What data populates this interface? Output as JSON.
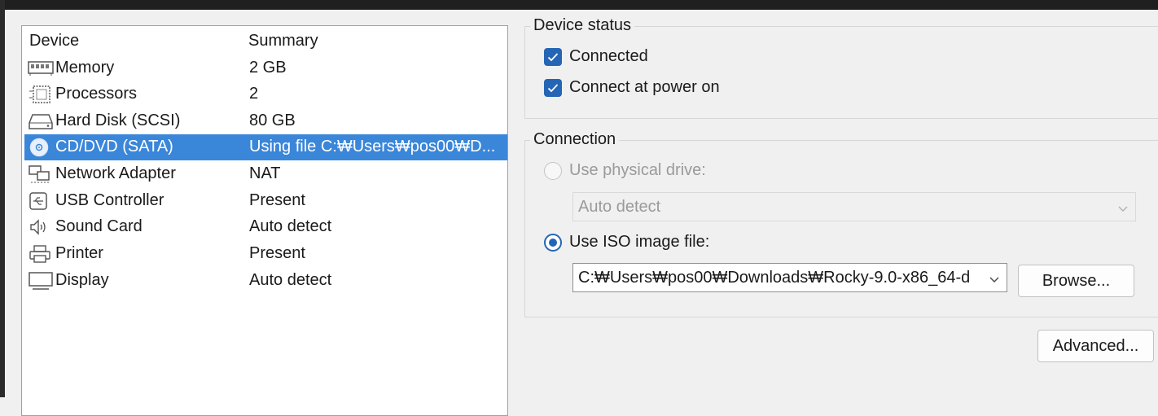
{
  "device_list": {
    "columns": {
      "device": "Device",
      "summary": "Summary"
    },
    "rows": [
      {
        "name": "Memory",
        "summary": "2 GB",
        "icon": "memory-icon",
        "selected": false
      },
      {
        "name": "Processors",
        "summary": "2",
        "icon": "processor-icon",
        "selected": false
      },
      {
        "name": "Hard Disk (SCSI)",
        "summary": "80 GB",
        "icon": "hard-disk-icon",
        "selected": false
      },
      {
        "name": "CD/DVD (SATA)",
        "summary": "Using file C:₩Users₩pos00₩D...",
        "icon": "cd-dvd-icon",
        "selected": true
      },
      {
        "name": "Network Adapter",
        "summary": "NAT",
        "icon": "network-adapter-icon",
        "selected": false
      },
      {
        "name": "USB Controller",
        "summary": "Present",
        "icon": "usb-icon",
        "selected": false
      },
      {
        "name": "Sound Card",
        "summary": "Auto detect",
        "icon": "speaker-icon",
        "selected": false
      },
      {
        "name": "Printer",
        "summary": "Present",
        "icon": "printer-icon",
        "selected": false
      },
      {
        "name": "Display",
        "summary": "Auto detect",
        "icon": "display-icon",
        "selected": false
      }
    ]
  },
  "device_status": {
    "title": "Device status",
    "connected": {
      "label": "Connected",
      "checked": true
    },
    "connect_at_power_on": {
      "label": "Connect at power on",
      "checked": true
    }
  },
  "connection": {
    "title": "Connection",
    "physical_drive": {
      "label": "Use physical drive:",
      "selected": false,
      "enabled": false,
      "value": "Auto detect"
    },
    "iso_image": {
      "label": "Use ISO image file:",
      "selected": true,
      "value": "C:₩Users₩pos00₩Downloads₩Rocky-9.0-x86_64-d"
    },
    "browse_label": "Browse..."
  },
  "advanced_label": "Advanced...",
  "colors": {
    "selection": "#3a86d9",
    "accent": "#2466b5"
  }
}
